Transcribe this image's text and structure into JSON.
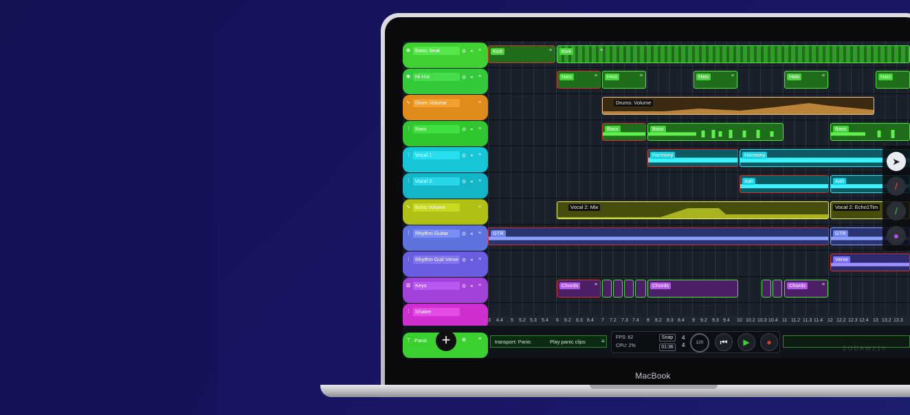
{
  "laptop": {
    "brand_label": "MacBook"
  },
  "tracks": [
    {
      "name": "Basic Beat",
      "icon": "drum-icon",
      "color": "#3fd12f",
      "name_bg": "#57e64a"
    },
    {
      "name": "Hi Hat",
      "icon": "drum-icon",
      "color": "#33c93a",
      "name_bg": "#46dc4b"
    },
    {
      "name": "Drum Volume",
      "icon": "automation-icon",
      "color": "#e08a1a",
      "name_bg": "#f3a032"
    },
    {
      "name": "Bass",
      "icon": "waveform-icon",
      "color": "#2fc62f",
      "name_bg": "#3fe03f"
    },
    {
      "name": "Vocal 1",
      "icon": "waveform-icon",
      "color": "#15c6d6",
      "name_bg": "#27def0"
    },
    {
      "name": "Vocal 2",
      "icon": "waveform-icon",
      "color": "#13b6c9",
      "name_bg": "#28d6ea"
    },
    {
      "name": "Echo Volume",
      "icon": "automation-icon",
      "color": "#b1c014",
      "name_bg": "#c8da22"
    },
    {
      "name": "Rhythm Guitar",
      "icon": "waveform-icon",
      "color": "#5f73e0",
      "name_bg": "#7a8cf5"
    },
    {
      "name": "Rhythm Guit Verse",
      "icon": "waveform-icon",
      "color": "#6a5de0",
      "name_bg": "#8475f2"
    },
    {
      "name": "Keys",
      "icon": "piano-icon",
      "color": "#a242d9",
      "name_bg": "#b758ee"
    },
    {
      "name": "Shaker",
      "icon": "waveform-icon",
      "color": "#cf2fd0",
      "name_bg": "#e44ae4"
    }
  ],
  "panic_track": {
    "name": "Panic",
    "add_button": "+"
  },
  "clips": {
    "kick_1": "Kick",
    "kick_2": "Kick",
    "hats": "Hats",
    "drums_volume": "Drums: Volume",
    "bass": "Bass",
    "harmony": "Harmony",
    "aah": "Aah",
    "vocal2_mix": "Vocal 2: Mix",
    "vocal2_echo": "Vocal 2: Echo1Tim",
    "gtr": "GTR",
    "verse": "Verse",
    "chords": "Chords"
  },
  "ruler_labels": [
    "3",
    "4.4",
    "5",
    "5.2",
    "5.3",
    "5.4",
    "6",
    "6.2",
    "6.3",
    "6.4",
    "7",
    "7.2",
    "7.3",
    "7.4",
    "8",
    "8.2",
    "8.3",
    "8.4",
    "9",
    "9.2",
    "9.3",
    "9.4",
    "10",
    "10.2",
    "10.3",
    "10.4",
    "11",
    "11.2",
    "11.3",
    "11.4",
    "12",
    "12.2",
    "12.3",
    "12.4",
    "13",
    "13.2",
    "13.3"
  ],
  "transport": {
    "panic_label": "transport: Panic",
    "panic_action": "Play panic clips",
    "fps": "FPS: 62",
    "cpu": "CPU: 2%",
    "snap": "Snap",
    "time": "01:36",
    "time_sig_top": "4",
    "time_sig_bottom": "4",
    "tempo": "120"
  },
  "watermark": "ZODAW210",
  "colors": {
    "accent_green": "#3ad12f",
    "record_red": "#e03b1f",
    "play_green": "#3ad12f"
  }
}
